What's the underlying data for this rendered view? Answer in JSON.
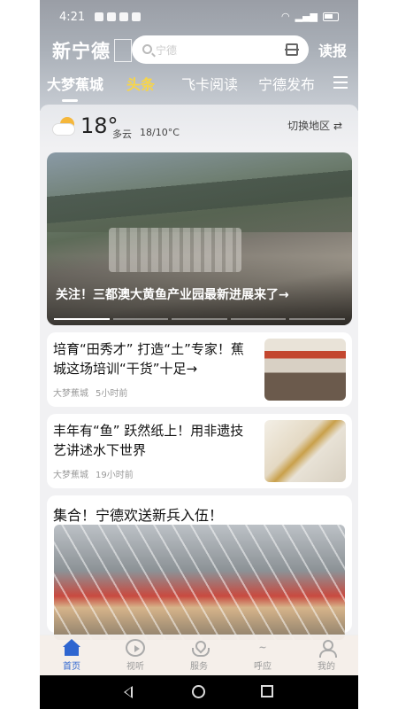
{
  "status_bar": {
    "time": "4:21"
  },
  "header": {
    "logo": "新宁德",
    "search_placeholder": "宁德",
    "read_paper": "读报"
  },
  "tabs": [
    {
      "label": "大梦蕉城"
    },
    {
      "label": "头条"
    },
    {
      "label": "飞卡阅读"
    },
    {
      "label": "宁德发布"
    }
  ],
  "weather": {
    "temperature": "18°",
    "condition": "多云",
    "range": "18/10°C",
    "switch_label": "切换地区 ⇄"
  },
  "feed": {
    "hero": {
      "caption": "关注！三都澳大黄鱼产业园最新进展来了→"
    },
    "items": [
      {
        "headline": "培育“田秀才” 打造“土”专家！蕉城这场培训“干货”十足→",
        "source": "大梦蕉城",
        "time": "5小时前"
      },
      {
        "headline": "丰年有“鱼” 跃然纸上！用非遗技艺讲述水下世界",
        "source": "大梦蕉城",
        "time": "19小时前"
      }
    ],
    "big": {
      "headline": "集合！宁德欢送新兵入伍！"
    }
  },
  "bottom_nav": [
    {
      "label": "首页",
      "icon": "home-icon"
    },
    {
      "label": "视听",
      "icon": "video-icon"
    },
    {
      "label": "服务",
      "icon": "service-icon"
    },
    {
      "label": "呼应",
      "icon": "respond-icon"
    },
    {
      "label": "我的",
      "icon": "profile-icon"
    }
  ],
  "colors": {
    "accent_blue": "#2f66d0",
    "tab_highlight": "#f7d54a"
  }
}
